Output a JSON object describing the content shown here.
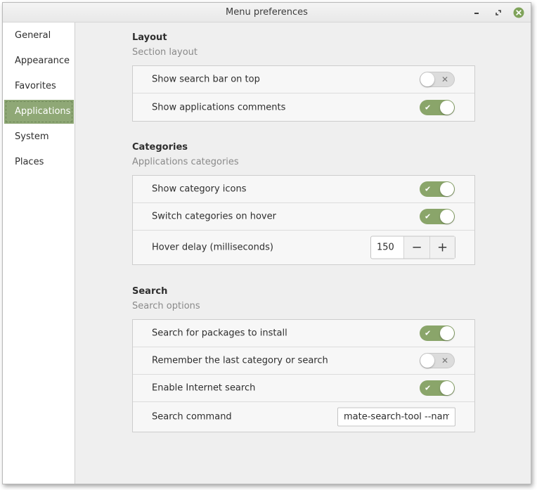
{
  "window": {
    "title": "Menu preferences"
  },
  "sidebar": {
    "items": [
      {
        "label": "General"
      },
      {
        "label": "Appearance"
      },
      {
        "label": "Favorites"
      },
      {
        "label": "Applications",
        "active": true
      },
      {
        "label": "System"
      },
      {
        "label": "Places"
      }
    ]
  },
  "sections": {
    "layout": {
      "title": "Layout",
      "subtitle": "Section layout",
      "rows": [
        {
          "label": "Show search bar on top",
          "on": false
        },
        {
          "label": "Show applications comments",
          "on": true
        }
      ]
    },
    "categories": {
      "title": "Categories",
      "subtitle": "Applications categories",
      "rows": [
        {
          "label": "Show category icons",
          "on": true
        },
        {
          "label": "Switch categories on hover",
          "on": true
        },
        {
          "label": "Hover delay (milliseconds)",
          "value": "150"
        }
      ]
    },
    "search": {
      "title": "Search",
      "subtitle": "Search options",
      "rows": [
        {
          "label": "Search for packages to install",
          "on": true
        },
        {
          "label": "Remember the last category or search",
          "on": false
        },
        {
          "label": "Enable Internet search",
          "on": true
        },
        {
          "label": "Search command",
          "value": "mate-search-tool --named"
        }
      ]
    }
  },
  "toggle_marks": {
    "on": "✔",
    "off": "✕"
  },
  "spin_buttons": {
    "minus": "−",
    "plus": "+"
  },
  "colors": {
    "accent": "#8aa56a",
    "sidebar_active": "#8fa876",
    "close_button": "#7fa35a"
  }
}
